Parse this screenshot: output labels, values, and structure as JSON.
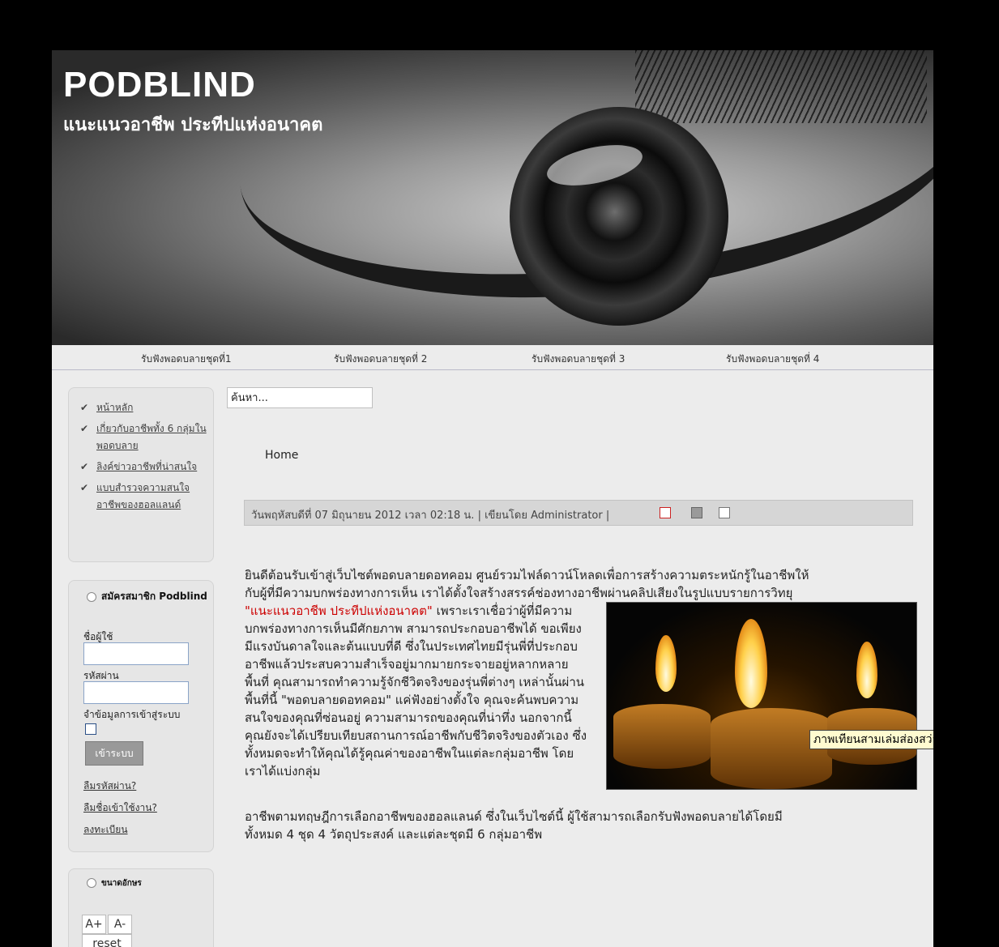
{
  "header": {
    "title": "PODBLIND",
    "tagline": "แนะแนวอาชีพ ประทีปแห่งอนาคต"
  },
  "nav": [
    "รับฟังพอดบลายชุดที่1",
    "รับฟังพอดบลายชุดที่ 2",
    "รับฟังพอดบลายชุดที่ 3",
    "รับฟังพอดบลายชุดที่ 4"
  ],
  "menu": [
    "หน้าหลัก",
    "เกี่ยวกับอาชีพทั้ง 6 กลุ่มในพอดบลาย",
    "ลิงค์ข่าวอาชีพที่น่าสนใจ",
    "แบบสำรวจความสนใจอาชีพของฮอลแลนด์"
  ],
  "login": {
    "title": "สมัครสมาชิก Podblind",
    "username_label": "ชื่อผู้ใช้",
    "password_label": "รหัสผ่าน",
    "remember_label": "จำข้อมูลการเข้าสู่ระบบ",
    "submit": "เข้าระบบ",
    "forgot_password": "ลืมรหัสผ่าน?",
    "forgot_username": "ลืมชื่อเข้าใช้งาน?",
    "register": "ลงทะเบียน"
  },
  "font_size": {
    "title": "ขนาดอักษร",
    "increase": "A+",
    "decrease": "A-",
    "reset": "reset"
  },
  "search": {
    "placeholder": "ค้นหา..."
  },
  "breadcrumb": "Home",
  "article": {
    "meta": "วันพฤหัสบดีที่ 07 มิถุนายน 2012 เวลา 02:18 น. | เขียนโดย Administrator |",
    "line1": "ยินดีต้อนรับเข้าสู่เว็บไซต์พอดบลายดอทคอม ศูนย์รวมไฟล์ดาวน์โหลดเพื่อการสร้างความตระหนักรู้ในอาชีพให้",
    "line2": "กับผู้ที่มีความบกพร่องทางการเห็น เราได้ตั้งใจสร้างสรรค์ช่องทางอาชีพผ่านคลิปเสียงในรูปแบบรายการวิทยุ",
    "quote": "\"แนะแนวอาชีพ ประทีปแห่งอนาคต\"",
    "wrapped": "เพราะเราเชื่อว่าผู้ที่มีความบกพร่องทางการเห็นมีศักยภาพ สามารถประกอบอาชีพได้ ขอเพียงมีแรงบันดาลใจและต้นแบบที่ดี ซึ่งในประเทศไทยมีรุ่นพี่ที่ประกอบอาชีพแล้วประสบความสำเร็จอยู่มากมายกระจายอยู่หลากหลายพื้นที่ คุณสามารถทำความรู้จักชีวิตจริงของรุ่นพี่ต่างๆ เหล่านั้นผ่านพื้นที่นี้ \"พอดบลายดอทคอม\" แค่ฟังอย่างตั้งใจ คุณจะค้นพบความสนใจของคุณที่ซ่อนอยู่ ความสามารถของคุณที่น่าทึ่ง นอกจากนี้คุณยังจะได้เปรียบเทียบสถานการณ์อาชีพกับชีวิตจริงของตัวเอง ซึ่งทั้งหมดจะทำให้คุณได้รู้คุณค่าของอาชีพในแต่ละกลุ่มอาชีพ โดยเราได้แบ่งกลุ่ม",
    "line_after1": "อาชีพตามทฤษฎีการเลือกอาชีพของฮอลแลนด์ ซึ่งในเว็บไซต์นี้ ผู้ใช้สามารถเลือกรับฟังพอดบลายได้โดยมี",
    "line_after2": "ทั้งหมด 4 ชุด 4 วัตถุประสงค์ และแต่ละชุดมี 6 กลุ่มอาชีพ",
    "image_caption": "ภาพเทียนสามเล่มส่องสว่าง"
  }
}
